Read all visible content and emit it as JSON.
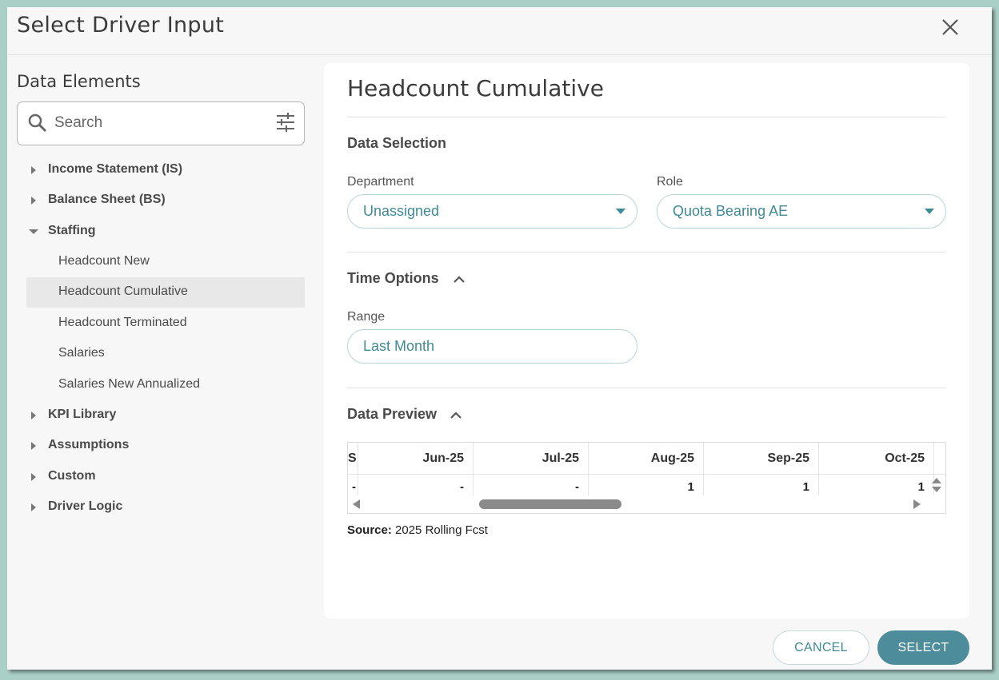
{
  "dialog": {
    "title": "Select Driver Input",
    "close_icon": "close-icon"
  },
  "left_panel": {
    "title": "Data Elements",
    "search": {
      "placeholder": "Search",
      "value": ""
    },
    "tree": [
      {
        "label": "Income Statement (IS)",
        "expanded": false
      },
      {
        "label": "Balance Sheet (BS)",
        "expanded": false
      },
      {
        "label": "Staffing",
        "expanded": true
      },
      {
        "label": "Headcount New",
        "child": true
      },
      {
        "label": "Headcount Cumulative",
        "child": true,
        "selected": true
      },
      {
        "label": "Headcount Terminated",
        "child": true
      },
      {
        "label": "Salaries",
        "child": true
      },
      {
        "label": "Salaries New Annualized",
        "child": true
      },
      {
        "label": "KPI Library",
        "expanded": false
      },
      {
        "label": "Assumptions",
        "expanded": false
      },
      {
        "label": "Custom",
        "expanded": false
      },
      {
        "label": "Driver Logic",
        "expanded": false
      }
    ]
  },
  "detail": {
    "title": "Headcount Cumulative",
    "data_selection": {
      "title": "Data Selection",
      "department_label": "Department",
      "department_value": "Unassigned",
      "role_label": "Role",
      "role_value": "Quota Bearing AE"
    },
    "time_options": {
      "title": "Time Options",
      "range_label": "Range",
      "range_value": "Last Month"
    },
    "data_preview": {
      "title": "Data Preview",
      "partial_header": "S",
      "partial_value": "-",
      "columns": [
        "Jun-25",
        "Jul-25",
        "Aug-25",
        "Sep-25",
        "Oct-25"
      ],
      "values": [
        "-",
        "-",
        "1",
        "1",
        "1"
      ],
      "source_label": "Source:",
      "source_value": "2025 Rolling Fcst"
    }
  },
  "footer": {
    "cancel_label": "CANCEL",
    "select_label": "SELECT"
  },
  "colors": {
    "accent": "#3f8a95",
    "primary_button": "#4d8c9a",
    "backdrop": "#a9cfc7"
  }
}
